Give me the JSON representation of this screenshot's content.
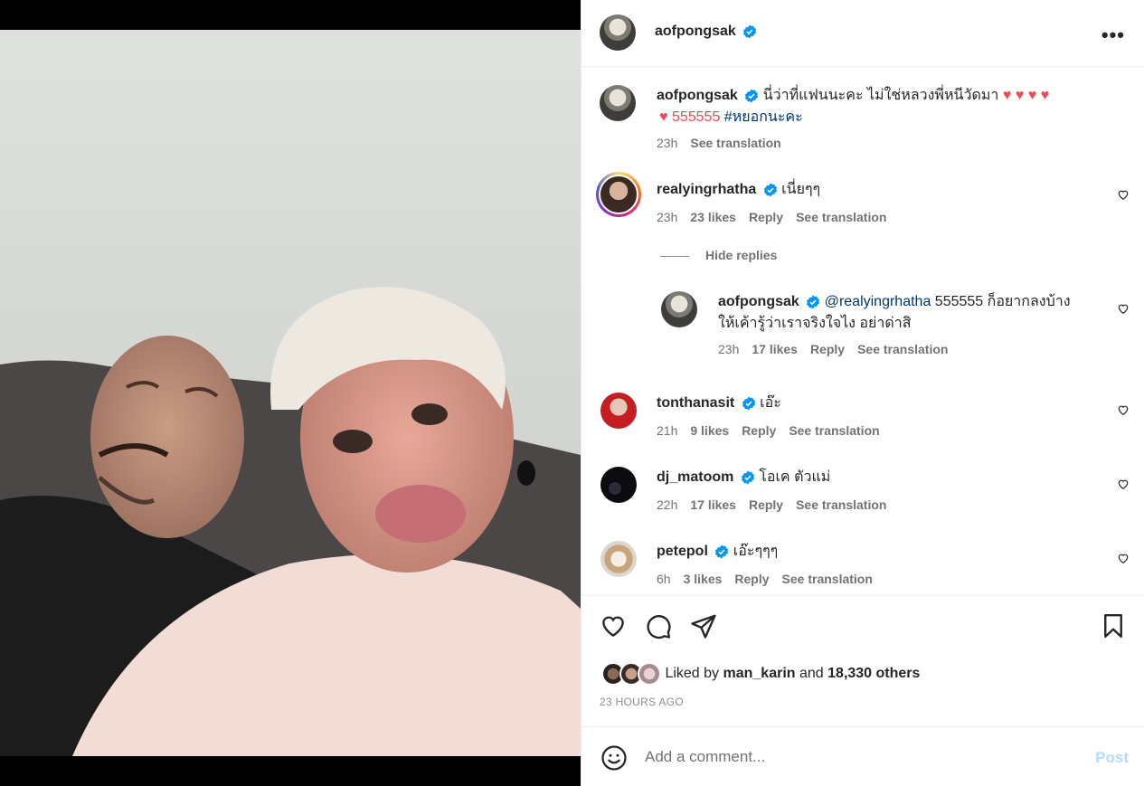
{
  "post": {
    "author": "aofpongsak",
    "author_icon": "verified-badge-icon",
    "more_label": "•••"
  },
  "caption": {
    "username": "aofpongsak",
    "text1": "นี่ว่าที่แฟนนะคะ ไม่ใช่หลวงพี่หนีวัดมา ♥ ♥ ♥ ♥",
    "text2_prefix": "♥ 555555 ",
    "hashtag": "#หยอกนะคะ",
    "time": "23h",
    "translate": "See translation"
  },
  "comments": [
    {
      "username": "realyingrhatha",
      "text": "เนี่ยๆๆ",
      "time": "23h",
      "likes": "23 likes",
      "reply": "Reply",
      "translate": "See translation"
    },
    {
      "username": "tonthanasit",
      "text": "เอ๊ะ",
      "time": "21h",
      "likes": "9 likes",
      "reply": "Reply",
      "translate": "See translation"
    },
    {
      "username": "dj_matoom",
      "text": "โอเค ตัวแม่",
      "time": "22h",
      "likes": "17 likes",
      "reply": "Reply",
      "translate": "See translation"
    },
    {
      "username": "petepol",
      "text": "เอ๊ะๆๆๆ",
      "time": "6h",
      "likes": "3 likes",
      "reply": "Reply",
      "translate": "See translation"
    }
  ],
  "hide_replies": "Hide replies",
  "reply": {
    "username": "aofpongsak",
    "mention": "@realyingrhatha",
    "text1": " 555555 ก็อยากลงบ้าง",
    "text2": "ให้เค้ารู้ว่าเราจริงใจไง อย่าด่าสิ",
    "time": "23h",
    "likes": "17 likes",
    "reply": "Reply",
    "translate": "See translation"
  },
  "actions": {
    "like_icon": "heart-icon",
    "comment_icon": "comment-icon",
    "share_icon": "send-icon",
    "save_icon": "bookmark-icon"
  },
  "likes": {
    "prefix": "Liked by ",
    "user": "man_karin",
    "middle": " and ",
    "others": "18,330 others"
  },
  "timestamp": "23 HOURS AGO",
  "add_comment": {
    "placeholder": "Add a comment...",
    "post_label": "Post",
    "emoji_icon": "emoji-icon"
  },
  "colors": {
    "verified": "#0095f6",
    "heart": "#ed4956",
    "link": "#00376b",
    "post_disabled": "#b3dbff"
  }
}
